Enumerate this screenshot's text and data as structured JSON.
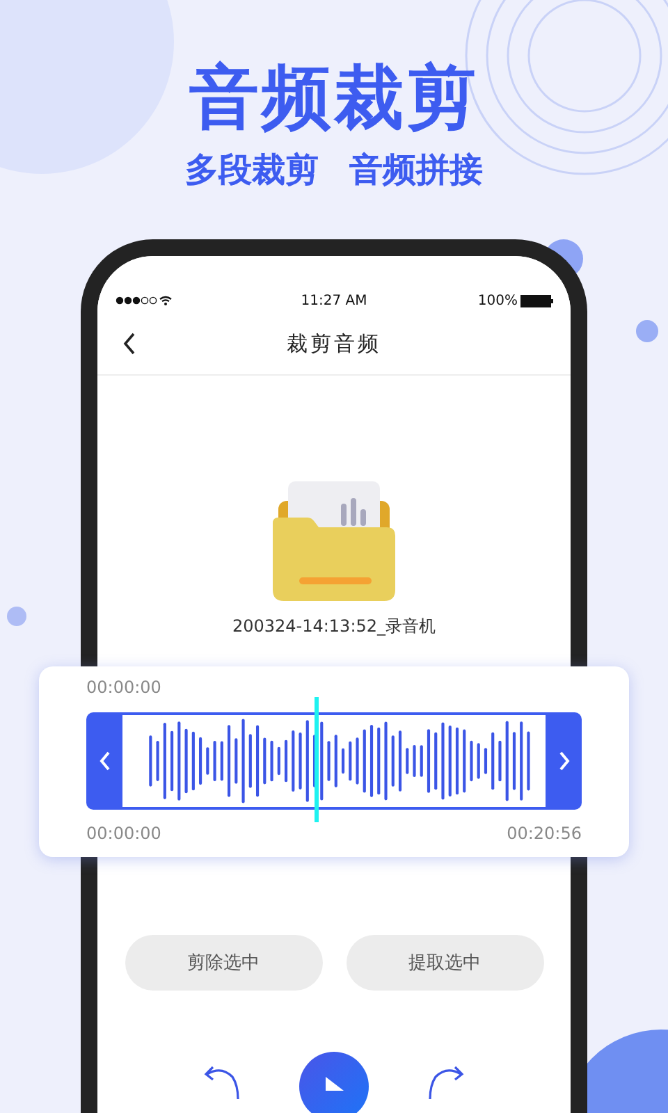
{
  "hero": {
    "title": "音频裁剪",
    "subtitle_items": [
      "多段裁剪",
      "音频拼接"
    ]
  },
  "status_bar": {
    "time": "11:27 AM",
    "battery": "100%"
  },
  "nav": {
    "title": "裁剪音频"
  },
  "file": {
    "name": "200324-14:13:52_录音机"
  },
  "trimmer": {
    "current_time": "00:00:00",
    "start_time": "00:00:00",
    "end_time": "00:20:56"
  },
  "buttons": [
    "剪除选中",
    "提取选中"
  ]
}
